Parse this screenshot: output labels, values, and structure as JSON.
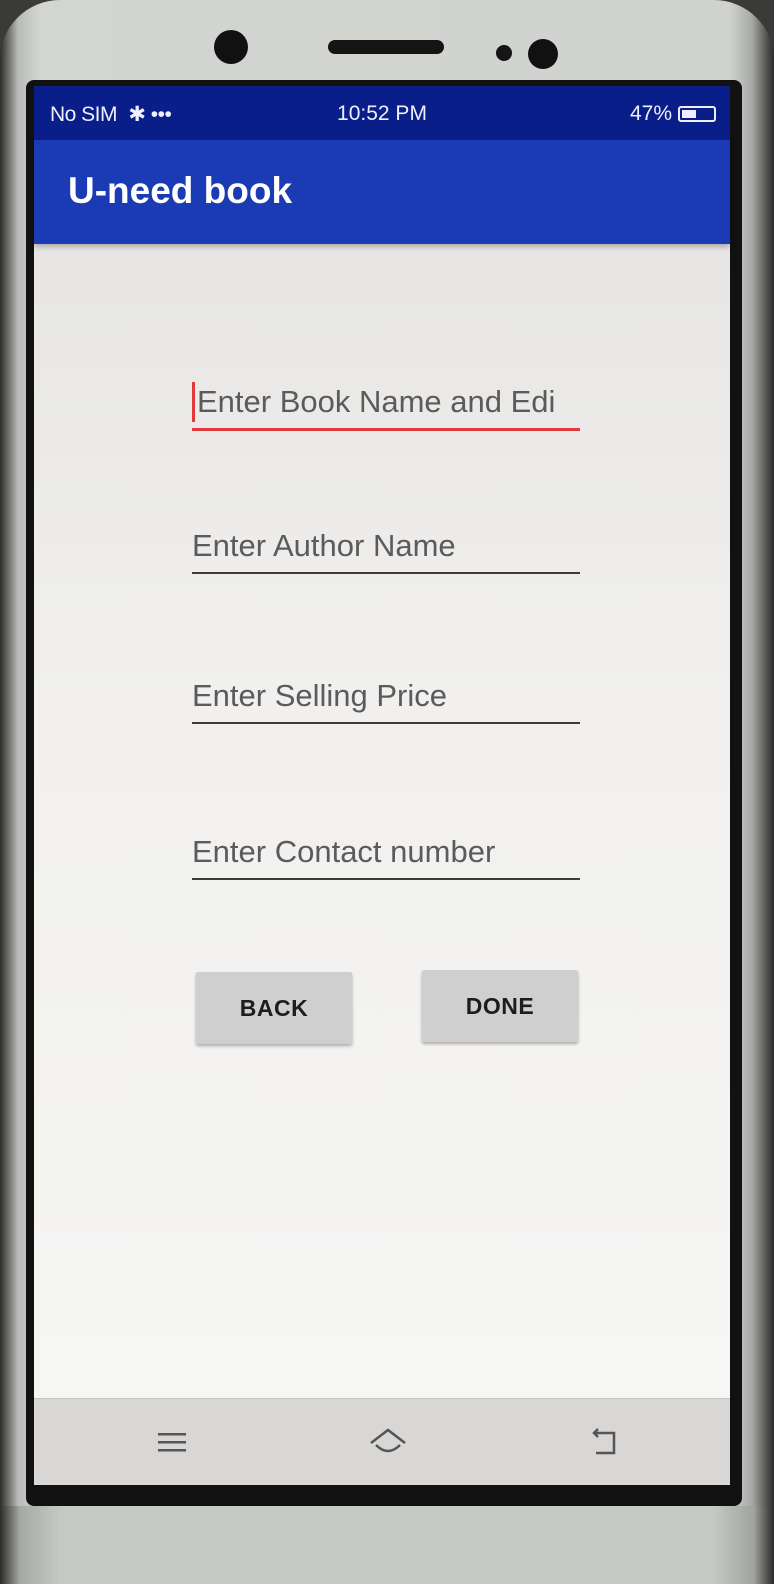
{
  "status_bar": {
    "carrier": "No SIM",
    "icons_extra": "✱ •••",
    "time": "10:52 PM",
    "battery_text": "47%",
    "battery_level": 0.47
  },
  "app_bar": {
    "title": "U-need book",
    "color": "#1b3bb5"
  },
  "form": {
    "book_name_placeholder": "Enter Book Name and Edi",
    "author_placeholder": "Enter Author Name",
    "price_placeholder": "Enter Selling Price",
    "contact_placeholder": "Enter Contact number",
    "focus_color": "#e0393e"
  },
  "buttons": {
    "back_label": "BACK",
    "done_label": "DONE"
  },
  "nav_bar": {
    "menu_icon": "menu-icon",
    "home_icon": "home-icon",
    "back_icon": "back-icon"
  }
}
